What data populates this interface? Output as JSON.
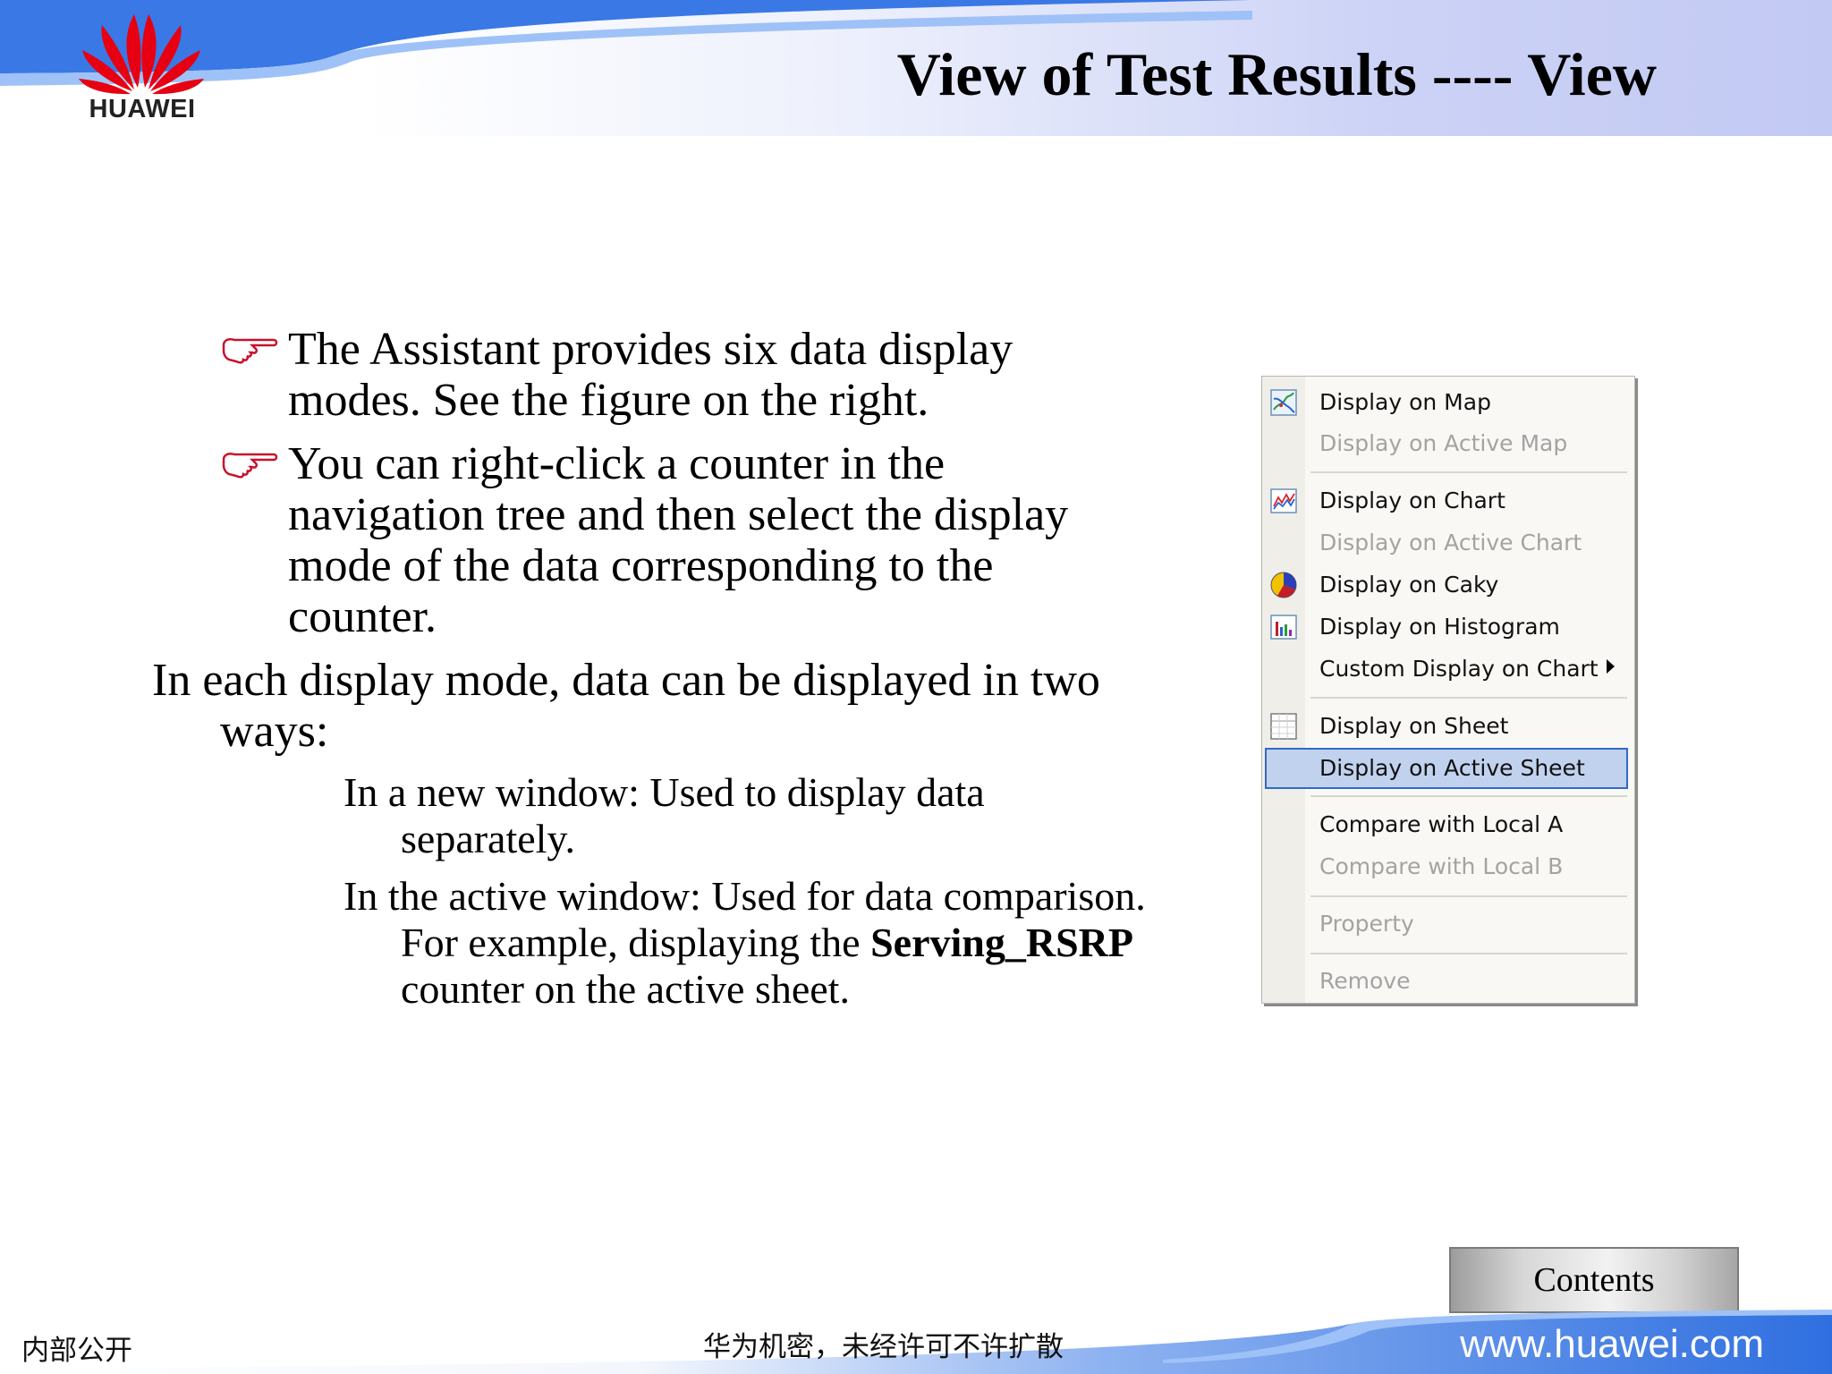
{
  "header": {
    "logo_text": "HUAWEI",
    "title": "View of Test Results ---- View"
  },
  "body": {
    "bullets": [
      "The Assistant provides six data display modes. See the figure on the right.",
      "You can right-click a counter in the navigation tree and then select the display mode of the data corresponding to the counter."
    ],
    "paragraph": "In each display mode, data can be displayed in two ways:",
    "sub1": "In a new window: Used to display data separately.",
    "sub2_before": "In the active window: Used for data comparison. For example, displaying the ",
    "sub2_bold": "Serving_RSRP",
    "sub2_after": " counter on the active sheet."
  },
  "menu": {
    "items": [
      {
        "label": "Display on Map",
        "icon": "map-icon",
        "enabled": true
      },
      {
        "label": "Display on Active Map",
        "enabled": false
      },
      {
        "label": "Display on Chart",
        "icon": "line-chart-icon",
        "enabled": true
      },
      {
        "label": "Display on Active Chart",
        "enabled": false
      },
      {
        "label": "Display on Caky",
        "icon": "pie-chart-icon",
        "enabled": true
      },
      {
        "label": "Display on Histogram",
        "icon": "histogram-icon",
        "enabled": true
      },
      {
        "label": "Custom Display on Chart",
        "enabled": true,
        "submenu": true
      },
      {
        "label": "Display on Sheet",
        "icon": "sheet-icon",
        "enabled": true
      },
      {
        "label": "Display on Active Sheet",
        "enabled": true,
        "selected": true
      },
      {
        "label": "Compare with Local A",
        "enabled": true
      },
      {
        "label": "Compare with Local B",
        "enabled": false
      },
      {
        "label": "Property",
        "enabled": false
      },
      {
        "label": "Remove",
        "enabled": false
      }
    ]
  },
  "footer": {
    "contents_button": "Contents",
    "left": "内部公开",
    "middle": "华为机密，未经许可不许扩散",
    "url": "www.huawei.com"
  },
  "colors": {
    "accent_blue": "#2f6fe0",
    "logo_red": "#e60012",
    "menu_highlight": "#c1d2ee"
  }
}
